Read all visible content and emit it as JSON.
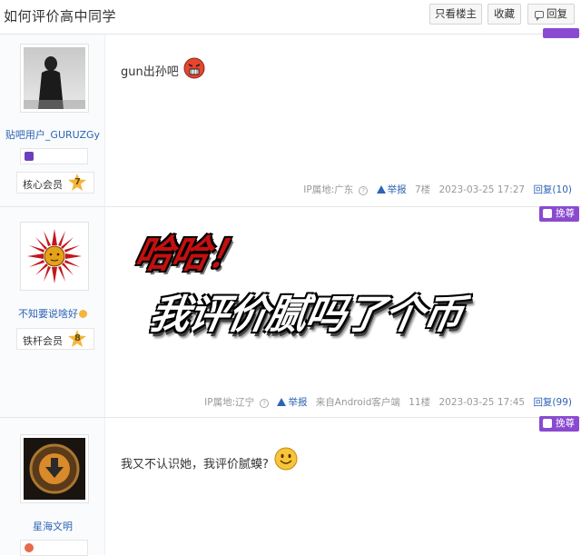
{
  "thread": {
    "title": "如何评价高中同学",
    "btn_author_only": "只看楼主",
    "btn_favorite": "收藏",
    "btn_reply": "回复"
  },
  "posts": [
    {
      "user": {
        "name": "贴吧用户_GURUZGy",
        "level_name": "核心会员",
        "level": "7"
      },
      "content": "gun出孙吧",
      "emoji": "angry-face-emoji",
      "ip": "IP属地:广东",
      "report": "举报",
      "floor": "7楼",
      "time": "2023-03-25 17:27",
      "reply": "回复(10)"
    },
    {
      "user": {
        "name": "不知要说啥好",
        "level_name": "铁杆会员",
        "level": "8"
      },
      "tip_label": "挽尊",
      "image_text": {
        "line1": "哈哈！",
        "line2": "我评价腻吗了个币"
      },
      "ip": "IP属地:辽宁",
      "report": "举报",
      "client": "来自Android客户端",
      "floor": "11楼",
      "time": "2023-03-25 17:45",
      "reply": "回复(99)"
    },
    {
      "user": {
        "name": "星海文明"
      },
      "tip_label": "挽尊",
      "content": "我又不认识她，我评价腻蟆?",
      "emoji": "smile-face-emoji"
    }
  ],
  "colors": {
    "accent_blue": "#2d64b3",
    "tip_purple": "#8a4ad0",
    "level_gold": "#f3b63a"
  }
}
